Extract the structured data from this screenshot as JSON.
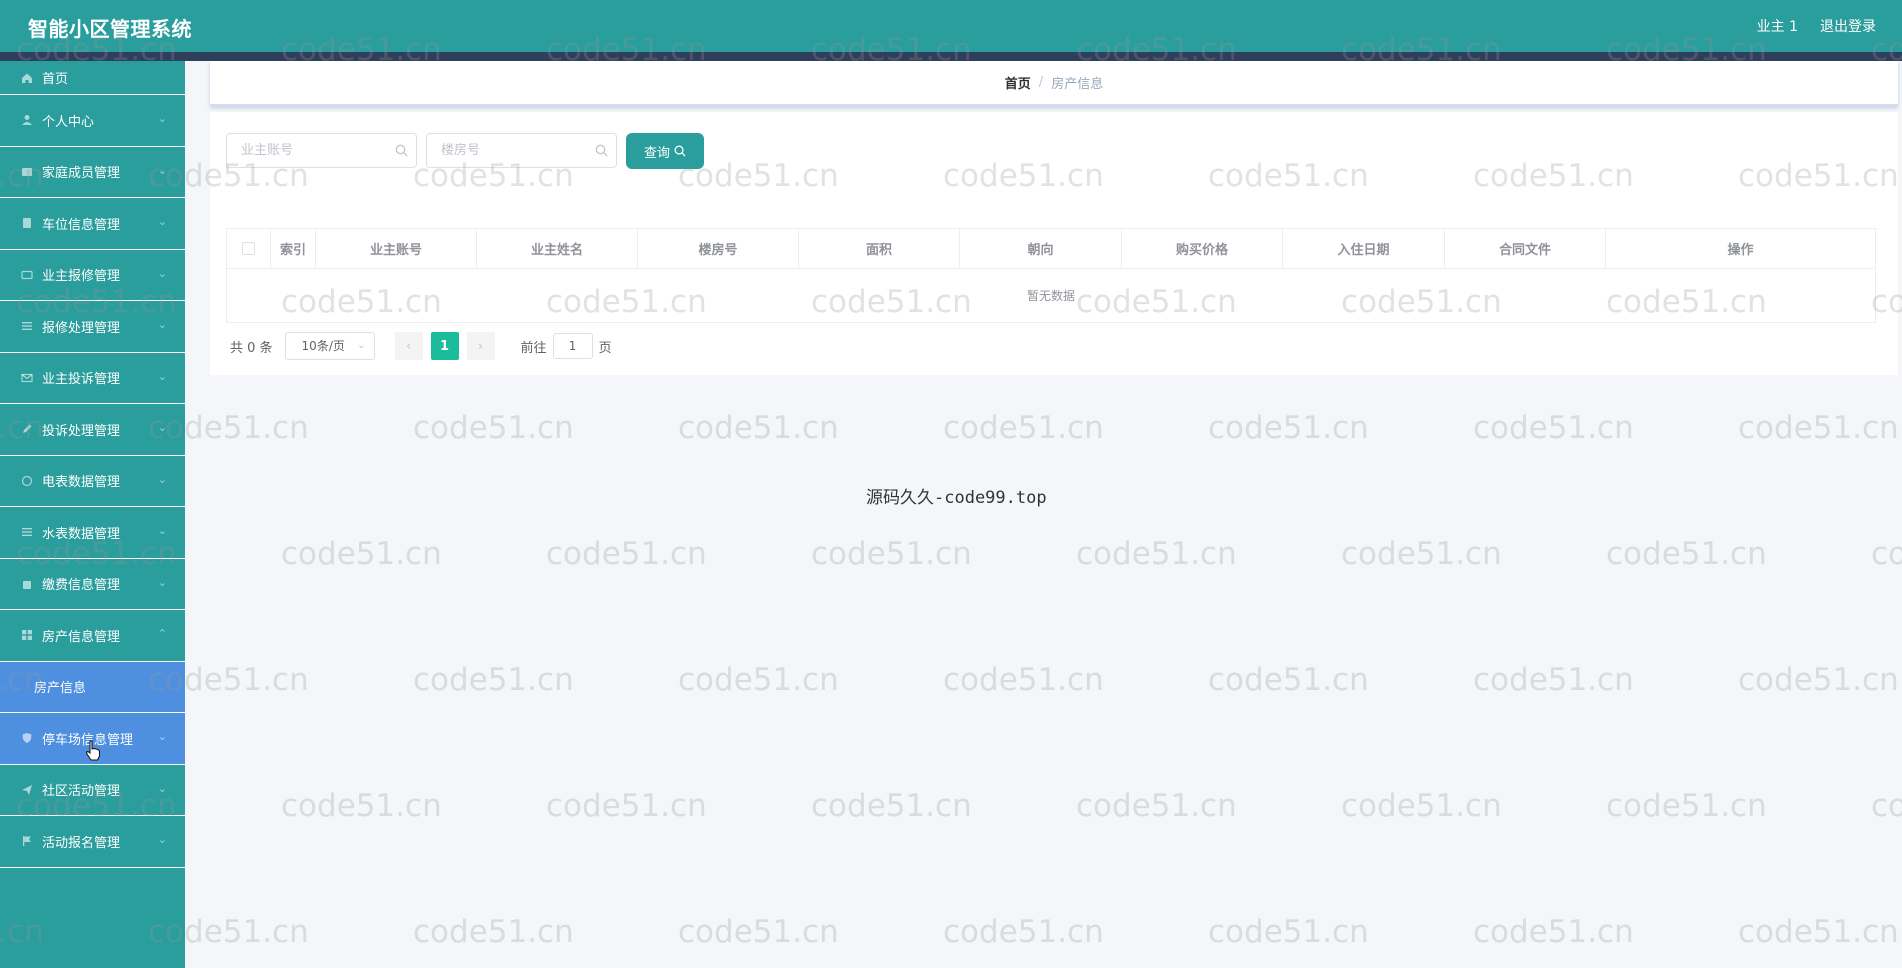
{
  "header": {
    "app_title": "智能小区管理系统",
    "user_label": "业主 1",
    "logout_label": "退出登录"
  },
  "sidebar": {
    "items": [
      {
        "label": "首页",
        "icon": "home-icon"
      },
      {
        "label": "个人中心",
        "icon": "user-icon"
      },
      {
        "label": "家庭成员管理",
        "icon": "people-icon"
      },
      {
        "label": "车位信息管理",
        "icon": "car-icon"
      },
      {
        "label": "业主报修管理",
        "icon": "card-icon"
      },
      {
        "label": "报修处理管理",
        "icon": "list-icon"
      },
      {
        "label": "业主投诉管理",
        "icon": "mail-icon"
      },
      {
        "label": "投诉处理管理",
        "icon": "edit-icon"
      },
      {
        "label": "电表数据管理",
        "icon": "clock-icon"
      },
      {
        "label": "水表数据管理",
        "icon": "list-icon"
      },
      {
        "label": "缴费信息管理",
        "icon": "bag-icon"
      },
      {
        "label": "房产信息管理",
        "icon": "grid-icon"
      },
      {
        "label": "房产信息",
        "icon": ""
      },
      {
        "label": "停车场信息管理",
        "icon": "shield-icon"
      },
      {
        "label": "社区活动管理",
        "icon": "send-icon"
      },
      {
        "label": "活动报名管理",
        "icon": "flag-icon"
      }
    ]
  },
  "breadcrumb": {
    "home": "首页",
    "separator": "/",
    "current": "房产信息"
  },
  "search": {
    "owner_account_placeholder": "业主账号",
    "building_placeholder": "楼房号",
    "query_label": "查询"
  },
  "table": {
    "columns": [
      "索引",
      "业主账号",
      "业主姓名",
      "楼房号",
      "面积",
      "朝向",
      "购买价格",
      "入住日期",
      "合同文件",
      "操作"
    ],
    "empty_text": "暂无数据"
  },
  "pagination": {
    "total_text": "共 0 条",
    "page_size": "10条/页",
    "current_page": "1",
    "goto_prefix": "前往",
    "goto_value": "1",
    "goto_suffix": "页"
  },
  "center_note": "源码久久-code99.top",
  "watermark_text": "code51.cn",
  "colors": {
    "primary": "#2a9d9d",
    "header_strip": "#2e3e5c",
    "active_menu": "#4e8fe0",
    "page_active": "#1abc9c"
  }
}
